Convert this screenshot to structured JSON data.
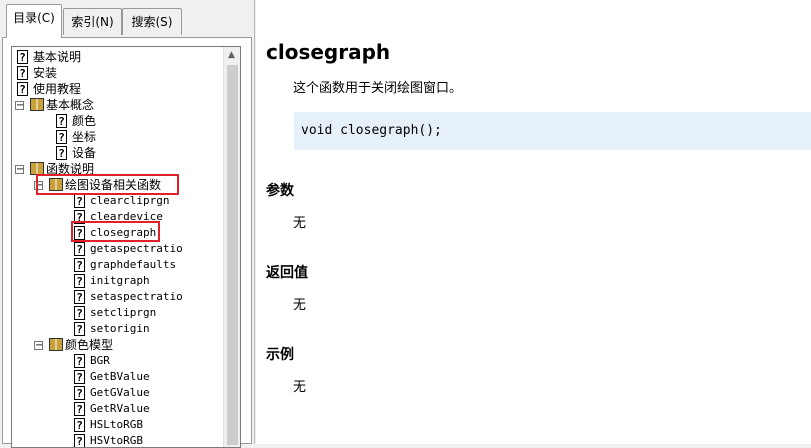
{
  "tabs": [
    {
      "label": "目录(C)"
    },
    {
      "label": "索引(N)"
    },
    {
      "label": "搜索(S)"
    }
  ],
  "tree": [
    {
      "label": "基本说明",
      "icon": "help-topic-icon",
      "level": 1
    },
    {
      "label": "安装",
      "icon": "help-topic-icon",
      "level": 1
    },
    {
      "label": "使用教程",
      "icon": "help-topic-icon",
      "level": 1
    },
    {
      "label": "基本概念",
      "icon": "book-icon",
      "level": 0,
      "expanded": true
    },
    {
      "label": "颜色",
      "icon": "help-topic-icon",
      "level": 2
    },
    {
      "label": "坐标",
      "icon": "help-topic-icon",
      "level": 2
    },
    {
      "label": "设备",
      "icon": "help-topic-icon",
      "level": 2
    },
    {
      "label": "函数说明",
      "icon": "book-icon",
      "level": 0,
      "expanded": true
    },
    {
      "label": "绘图设备相关函数",
      "icon": "book-icon",
      "level": 1,
      "expanded": true
    },
    {
      "label": "clearcliprgn",
      "icon": "help-topic-icon",
      "level": 3
    },
    {
      "label": "cleardevice",
      "icon": "help-topic-icon",
      "level": 3
    },
    {
      "label": "closegraph",
      "icon": "help-topic-icon",
      "level": 3
    },
    {
      "label": "getaspectratio",
      "icon": "help-topic-icon",
      "level": 3
    },
    {
      "label": "graphdefaults",
      "icon": "help-topic-icon",
      "level": 3
    },
    {
      "label": "initgraph",
      "icon": "help-topic-icon",
      "level": 3
    },
    {
      "label": "setaspectratio",
      "icon": "help-topic-icon",
      "level": 3
    },
    {
      "label": "setcliprgn",
      "icon": "help-topic-icon",
      "level": 3
    },
    {
      "label": "setorigin",
      "icon": "help-topic-icon",
      "level": 3
    },
    {
      "label": "颜色模型",
      "icon": "book-icon",
      "level": 1,
      "expanded": true
    },
    {
      "label": "BGR",
      "icon": "help-topic-icon",
      "level": 3
    },
    {
      "label": "GetBValue",
      "icon": "help-topic-icon",
      "level": 3
    },
    {
      "label": "GetGValue",
      "icon": "help-topic-icon",
      "level": 3
    },
    {
      "label": "GetRValue",
      "icon": "help-topic-icon",
      "level": 3
    },
    {
      "label": "HSLtoRGB",
      "icon": "help-topic-icon",
      "level": 3
    },
    {
      "label": "HSVtoRGB",
      "icon": "help-topic-icon",
      "level": 3
    }
  ],
  "content": {
    "title": "closegraph",
    "description": "这个函数用于关闭绘图窗口。",
    "code": "void closegraph();",
    "params_heading": "参数",
    "params_value": "无",
    "return_heading": "返回值",
    "return_value": "无",
    "example_heading": "示例",
    "example_value": "无"
  },
  "colors": {
    "highlight_box": "#e0202a",
    "code_background": "#e6f0f8"
  }
}
